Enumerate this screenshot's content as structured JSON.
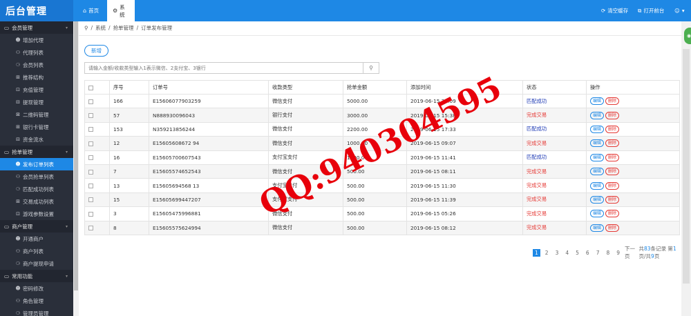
{
  "header": {
    "brand": "后台管理",
    "tabs": [
      {
        "label": "首页",
        "icon": "home-icon"
      },
      {
        "label": "系统",
        "icon": "gear-icon"
      }
    ],
    "actions": [
      {
        "label": "清空缓存",
        "icon": "refresh-icon"
      },
      {
        "label": "打开前台",
        "icon": "external-link-icon"
      }
    ],
    "user_icon": "user-icon"
  },
  "sidebar": {
    "groups": [
      {
        "label": "会员管理",
        "items": [
          "增加代理",
          "代理列表",
          "会员列表",
          "推荐结构",
          "充值管理",
          "提现管理",
          "二维码管理",
          "银行卡管理",
          "资金流水"
        ]
      },
      {
        "label": "抢单管理",
        "items": [
          "发布订单列表",
          "会员抢单列表",
          "匹配成功列表",
          "交易成功列表",
          "游戏参数设置"
        ]
      },
      {
        "label": "商户管理",
        "items": [
          "开通商户",
          "商户列表",
          "商户提现申请"
        ]
      },
      {
        "label": "常用功能",
        "items": [
          "密码修改",
          "角色管理",
          "管理员管理"
        ]
      }
    ]
  },
  "breadcrumb": [
    "系统",
    "抢单管理",
    "订单发布管理"
  ],
  "toolbar": {
    "add_label": "新增"
  },
  "search": {
    "placeholder": "请输入金额/收款类型输入1表示微信、2支付宝、3银行",
    "value": ""
  },
  "table": {
    "headers": [
      "序号",
      "订单号",
      "收款类型",
      "抢单金额",
      "添加时间",
      "状态",
      "操作"
    ],
    "rows": [
      {
        "id": "166",
        "order": "E15606077903259",
        "type": "微信支付",
        "amount": "5000.00",
        "time": "2019-06-15 22:09",
        "status": "匹配成功",
        "status_kind": "blue"
      },
      {
        "id": "57",
        "order": "N888930096043",
        "type": "银行支付",
        "amount": "3000.00",
        "time": "2019-06-15 15:38",
        "status": "完成交易",
        "status_kind": "red"
      },
      {
        "id": "153",
        "order": "N359213856244",
        "type": "微信支付",
        "amount": "2200.00",
        "time": "2019-06-15 17:33",
        "status": "匹配成功",
        "status_kind": "blue"
      },
      {
        "id": "12",
        "order": "E15605608672 94",
        "type": "微信支付",
        "amount": "1000.00",
        "time": "2019-06-15 09:07",
        "status": "完成交易",
        "status_kind": "red"
      },
      {
        "id": "16",
        "order": "E15605700607543",
        "type": "支付宝支付",
        "amount": "1000.00",
        "time": "2019-06-15 11:41",
        "status": "匹配成功",
        "status_kind": "blue"
      },
      {
        "id": "7",
        "order": "E15605574652543",
        "type": "微信支付",
        "amount": "500.00",
        "time": "2019-06-15 08:11",
        "status": "完成交易",
        "status_kind": "red"
      },
      {
        "id": "13",
        "order": "E15605694568 13",
        "type": "支付宝支付",
        "amount": "500.00",
        "time": "2019-06-15 11:30",
        "status": "完成交易",
        "status_kind": "red"
      },
      {
        "id": "15",
        "order": "E15605699447207",
        "type": "支付宝支付",
        "amount": "500.00",
        "time": "2019-06-15 11:39",
        "status": "完成交易",
        "status_kind": "red"
      },
      {
        "id": "3",
        "order": "E15605475996881",
        "type": "微信支付",
        "amount": "500.00",
        "time": "2019-06-15 05:26",
        "status": "完成交易",
        "status_kind": "red"
      },
      {
        "id": "8",
        "order": "E15605575624994",
        "type": "微信支付",
        "amount": "500.00",
        "time": "2019-06-15 08:12",
        "status": "完成交易",
        "status_kind": "red"
      }
    ],
    "edit_label": "编辑",
    "delete_label": "删除"
  },
  "pagination": {
    "pages": [
      "1",
      "2",
      "3",
      "4",
      "5",
      "6",
      "7",
      "8",
      "9"
    ],
    "current": "1",
    "next_label": "下一页",
    "summary_prefix": "共",
    "total": "83",
    "summary_mid": "条记录 第",
    "page": "1",
    "summary_mid2": "页/共",
    "page_count": "9",
    "summary_suffix": "页"
  },
  "watermark": {
    "text": "QQ:940304595",
    "color": "#e8000b"
  },
  "colors": {
    "accent": "#1e88e5",
    "sidebar_bg": "#2a2f3a",
    "status_blue": "#1e3ab5",
    "status_red": "#e53935"
  }
}
